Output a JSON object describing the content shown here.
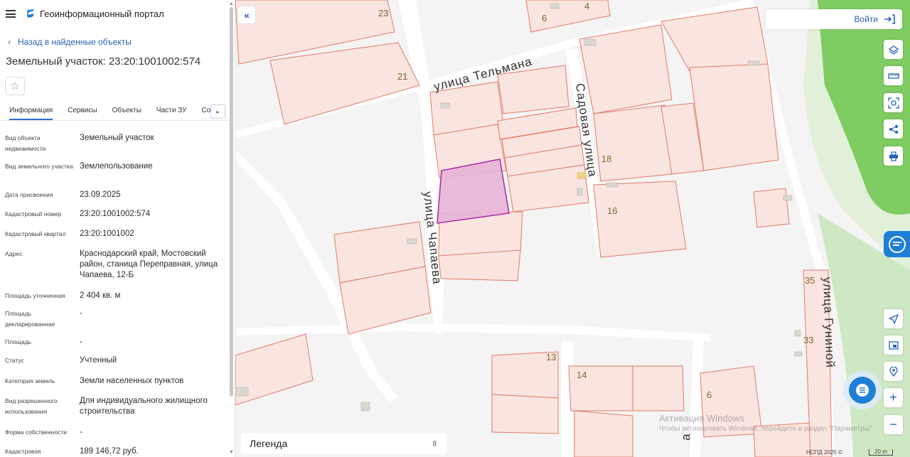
{
  "app": {
    "title": "Геоинформационный портал"
  },
  "nav": {
    "back_label": "Назад в найденные объекты"
  },
  "object": {
    "title": "Земельный участок: 23:20:1001002:574"
  },
  "tabs": [
    "Информация",
    "Сервисы",
    "Объекты",
    "Части ЗУ",
    "Соста"
  ],
  "active_tab": "Информация",
  "info": {
    "vid_obekta": {
      "label": "Вид объекта недвижимости",
      "value": "Земельный участок"
    },
    "vid_zu": {
      "label": "Вид земельного участка",
      "value": "Землепользование"
    },
    "data_prisvoeniya": {
      "label": "Дата присвоения",
      "value": "23.09.2025"
    },
    "kad_nomer": {
      "label": "Кадастровый номер",
      "value": "23:20:1001002:574"
    },
    "kad_kvartal": {
      "label": "Кадастровый квартал",
      "value": "23:20:1001002"
    },
    "adres": {
      "label": "Адрес",
      "value": "Краснодарский край, Мостовский район, станица Переправная, улица Чапаева, 12-Б"
    },
    "ploshchad_utochn": {
      "label": "Площадь уточненная",
      "value": "2 404 кв. м"
    },
    "ploshchad_dekl": {
      "label": "Площадь декларированная",
      "value": "-"
    },
    "ploshchad": {
      "label": "Площадь",
      "value": "-"
    },
    "status": {
      "label": "Статус",
      "value": "Учтенный"
    },
    "kategoriya": {
      "label": "Категория земель",
      "value": "Земли населенных пунктов"
    },
    "vri": {
      "label": "Вид разрешенного использования",
      "value": "Для индивидуального жилищного строительства"
    },
    "forma_sobstv": {
      "label": "Форма собственности",
      "value": "-"
    },
    "kad_stoimost": {
      "label": "Кадастровая",
      "value": "189 146,72 руб."
    }
  },
  "map": {
    "streets": [
      "улица Тельмана",
      "Садовая улица",
      "улица Чапаева",
      "улица Гуниной"
    ],
    "partial_street_label": "а",
    "house_numbers": [
      "23",
      "4",
      "6",
      "21",
      "18",
      "16",
      "35",
      "33",
      "13",
      "14",
      "6"
    ],
    "login_label": "Войти",
    "legend_label": "Легенда",
    "watermark_line1": "Активация Windows",
    "watermark_line2": "Чтобы активировать Windows, перейдите в раздел \"Параметры\".",
    "attribution": "НСПД 2025 ©",
    "scale_label": "20 m",
    "colors": {
      "parcel_fill": "#fbe3de",
      "parcel_stroke": "#e0705a",
      "selected_fill": "#e8b4d8",
      "selected_stroke": "#a020a0",
      "road": "#ffffff",
      "green": "#7fcc62"
    }
  }
}
